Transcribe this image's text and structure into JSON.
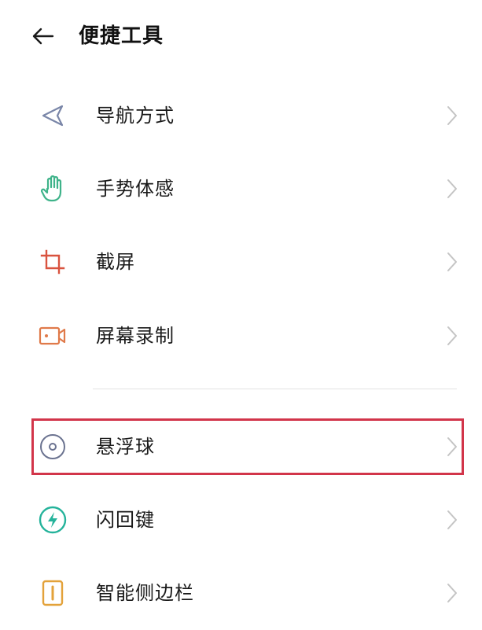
{
  "header": {
    "title": "便捷工具",
    "back_icon": "arrow-left-icon"
  },
  "items": [
    {
      "label": "导航方式",
      "icon": "navigation-arrow-icon",
      "color": "#7a86a8"
    },
    {
      "label": "手势体感",
      "icon": "hand-gesture-icon",
      "color": "#3fb38a"
    },
    {
      "label": "截屏",
      "icon": "crop-icon",
      "color": "#d9533f"
    },
    {
      "label": "屏幕录制",
      "icon": "video-camera-icon",
      "color": "#e07a4a"
    },
    {
      "label": "悬浮球",
      "icon": "floating-ball-icon",
      "color": "#6b7390"
    },
    {
      "label": "闪回键",
      "icon": "lightning-icon",
      "color": "#25b39b"
    },
    {
      "label": "智能侧边栏",
      "icon": "sidebar-icon",
      "color": "#e3a23a"
    }
  ],
  "highlight_color": "#d2354a"
}
